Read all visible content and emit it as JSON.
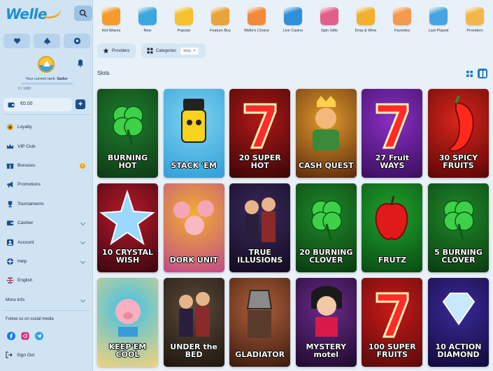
{
  "brand": {
    "logo": "Welle"
  },
  "rank": {
    "label": "Your current rank:",
    "value": "Sailor",
    "progress": "0 / 1000",
    "progress_fraction": 0.0
  },
  "balance": {
    "amount": "€0.00",
    "add": "+"
  },
  "menu": [
    {
      "label": "Loyalty",
      "icon": "loyalty-icon"
    },
    {
      "label": "VIP Club",
      "icon": "crown-icon"
    },
    {
      "label": "Bonuses",
      "icon": "gift-icon",
      "badge": "2"
    },
    {
      "label": "Promotions",
      "icon": "megaphone-icon"
    },
    {
      "label": "Tournaments",
      "icon": "trophy-icon"
    },
    {
      "label": "Cashier",
      "icon": "wallet-icon",
      "expand": true
    },
    {
      "label": "Account",
      "icon": "user-icon",
      "expand": true
    },
    {
      "label": "Help",
      "icon": "lifebuoy-icon",
      "expand": true
    },
    {
      "label": "English",
      "icon": "uk-flag-icon"
    },
    {
      "label": "More info",
      "icon": "",
      "expand": true
    }
  ],
  "social": {
    "title": "Follow us on social media",
    "icons": [
      "facebook-icon",
      "instagram-icon",
      "telegram-icon"
    ]
  },
  "signout": "Sign Out",
  "categories": [
    {
      "label": "Hot Waves",
      "color": "#f59b2c"
    },
    {
      "label": "New",
      "color": "#3ba7e0"
    },
    {
      "label": "Popular",
      "color": "#f5c12e"
    },
    {
      "label": "Feature Buy",
      "color": "#e8a33a"
    },
    {
      "label": "Welle's Choice",
      "color": "#f08a3a"
    },
    {
      "label": "Live Casino",
      "color": "#2f8fd8"
    },
    {
      "label": "Spin Gifts",
      "color": "#e25f8c"
    },
    {
      "label": "Drop & Wins",
      "color": "#f3b02a"
    },
    {
      "label": "Favorites",
      "color": "#f29a4e"
    },
    {
      "label": "Last Played",
      "color": "#45a5e0"
    },
    {
      "label": "Providers",
      "color": "#f2b64a"
    }
  ],
  "filters": {
    "providers": "Providers",
    "categories": "Categories",
    "active_tag": "Slots"
  },
  "section": {
    "title": "Slots"
  },
  "games": [
    {
      "title": "BURNING HOT",
      "bg1": "#1f7d2e",
      "bg2": "#0d3a14",
      "motif": "clover"
    },
    {
      "title": "STACK 'EM",
      "bg1": "#7fd3f0",
      "bg2": "#2f9ed8",
      "motif": "mascot"
    },
    {
      "title": "20 SUPER HOT",
      "bg1": "#b01818",
      "bg2": "#3a0606",
      "motif": "seven"
    },
    {
      "title": "CASH QUEST",
      "bg1": "#e09a2c",
      "bg2": "#5a2a0c",
      "motif": "knight"
    },
    {
      "title": "27 Fruit WAYS",
      "bg1": "#8a2fc4",
      "bg2": "#3a0e5e",
      "motif": "seven"
    },
    {
      "title": "30 SPICY FRUITS",
      "bg1": "#d8261c",
      "bg2": "#5a0606",
      "motif": "pepper"
    },
    {
      "title": "10 CRYSTAL WISH",
      "bg1": "#b81a2a",
      "bg2": "#3a0610",
      "motif": "star"
    },
    {
      "title": "DORK UNIT",
      "bg1": "#f0b030",
      "bg2": "#c04a8a",
      "motif": "pigs"
    },
    {
      "title": "TRUE ILLUSIONS",
      "bg1": "#3a2a5a",
      "bg2": "#120a22",
      "motif": "people"
    },
    {
      "title": "20 BURNING CLOVER",
      "bg1": "#1f8a2a",
      "bg2": "#0a3a10",
      "motif": "clover"
    },
    {
      "title": "FRUTZ",
      "bg1": "#1ea42c",
      "bg2": "#0a4a14",
      "motif": "apple"
    },
    {
      "title": "5 BURNING CLOVER",
      "bg1": "#1f8a2a",
      "bg2": "#0a3a10",
      "motif": "clover"
    },
    {
      "title": "KEEP'EM COOL",
      "bg1": "#3fc1ea",
      "bg2": "#f2d27a",
      "motif": "pig"
    },
    {
      "title": "UNDER the BED",
      "bg1": "#5a4a3a",
      "bg2": "#1e160e",
      "motif": "people"
    },
    {
      "title": "GLADIATOR",
      "bg1": "#b0603a",
      "bg2": "#3a1a0e",
      "motif": "gladiator"
    },
    {
      "title": "MYSTERY motel",
      "bg1": "#6a2a8a",
      "bg2": "#1e0a2e",
      "motif": "woman"
    },
    {
      "title": "100 SUPER FRUITS",
      "bg1": "#c81a1a",
      "bg2": "#5a0a0a",
      "motif": "seven"
    },
    {
      "title": "10 ACTION DIAMOND",
      "bg1": "#3a2a9a",
      "bg2": "#120a3a",
      "motif": "diamond"
    }
  ]
}
